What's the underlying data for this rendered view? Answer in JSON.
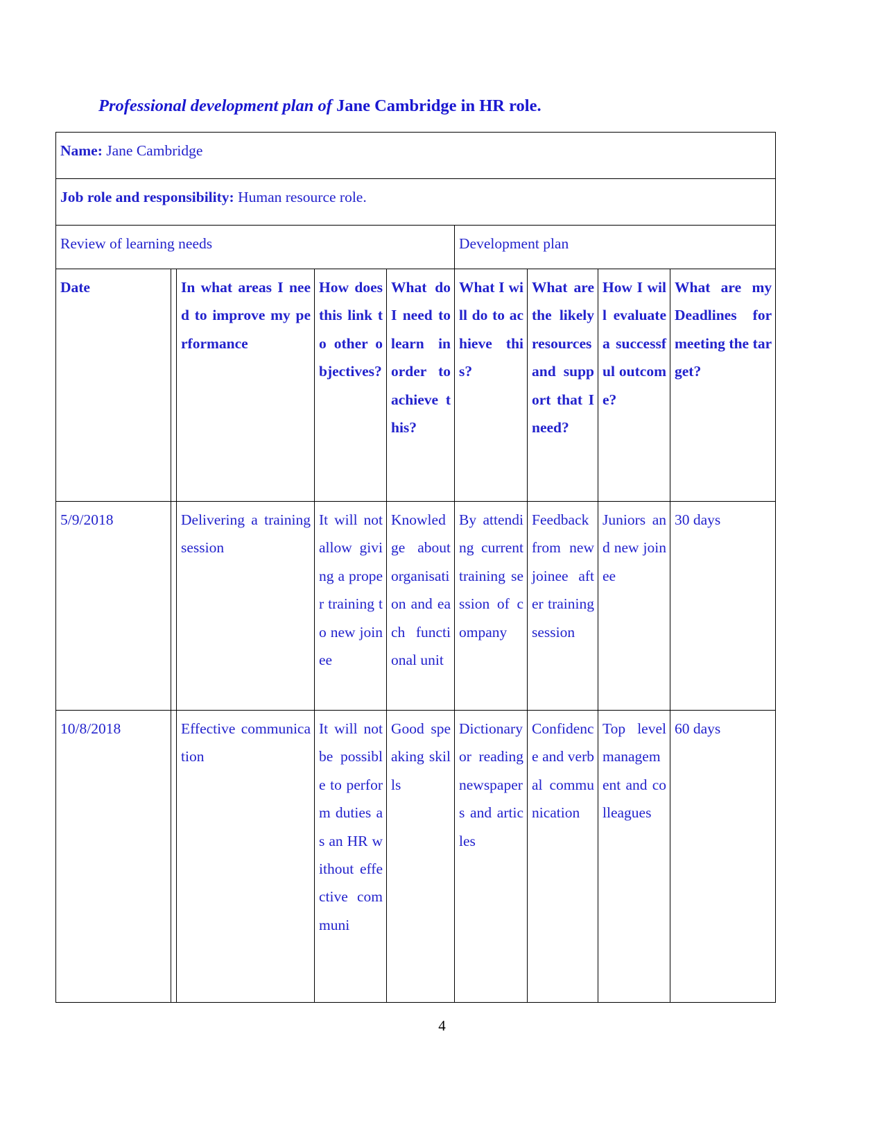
{
  "document": {
    "title_italic_part": "Professional development plan of ",
    "title_bold_part": "Jane Cambridge in HR role.",
    "page_number": "4",
    "text_color": "#2222cc",
    "heading_color": "#1a18d0"
  },
  "info_rows": {
    "name_label": "Name:",
    "name_value": " Jane Cambridge",
    "job_label": "Job role and responsibility:",
    "job_value": " Human resource role."
  },
  "group_headers": {
    "left": "Review of learning needs",
    "right": "Development plan"
  },
  "column_headers": [
    "Date",
    "In what areas I need to improve my performance",
    "How does this link to other objectives?",
    "What do I need to learn in order to achieve this?",
    "What I will do to achieve this?",
    "What are the likely resources and support that I need?",
    "How I will evaluate a successful outcome?",
    "What are my Deadlines for meeting the target?"
  ],
  "rows": [
    {
      "date": "5/9/2018",
      "improve_area": "Delivering a training session",
      "link_to_objectives": "It will not allow giving a proper training to new joinee",
      "need_to_learn": "Knowledge about organisation and each functional unit",
      "what_will_do": "By attending current training session of company",
      "resources_support": "Feedback from new joinee after training session",
      "evaluate_outcome": "Juniors and new joinee",
      "deadline": "30 days"
    },
    {
      "date": "10/8/2018",
      "improve_area": " Effective communication",
      "link_to_objectives": "It will not be possible to perform duties as an HR without effective communi",
      "need_to_learn": "Good speaking skills",
      "what_will_do": "Dictionary or reading newspapers and articles",
      "resources_support": "Confidence and verbal communication",
      "evaluate_outcome": "Top level management and colleagues",
      "deadline": "60 days"
    }
  ]
}
